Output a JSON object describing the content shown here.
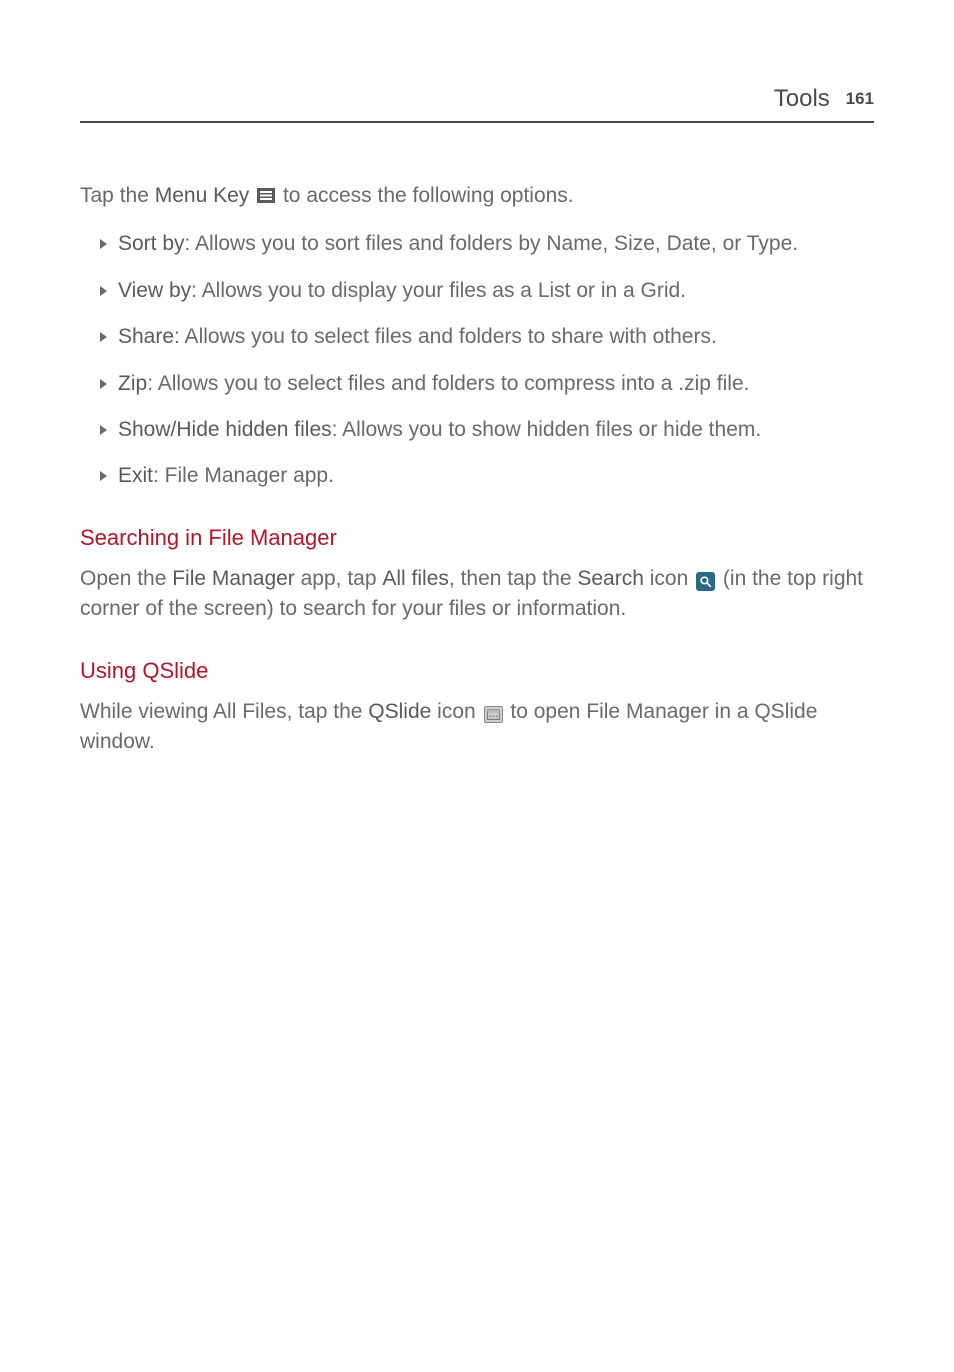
{
  "header": {
    "section": "Tools",
    "page": "161"
  },
  "intro": {
    "prefix": "Tap the ",
    "bold1": "Menu Key",
    "suffix": " to access the following options."
  },
  "items": [
    {
      "bold": "Sort by",
      "desc": ": Allows you to sort files and folders by Name, Size, Date, or Type."
    },
    {
      "bold": "View by",
      "desc": ": Allows you to display your files as a List or in a Grid."
    },
    {
      "bold": "Share",
      "desc": ": Allows you to select files and folders to share with others."
    },
    {
      "bold": "Zip",
      "desc": ": Allows you to select files and folders to compress into a .zip file."
    },
    {
      "bold": "Show/Hide hidden files",
      "desc": ": Allows you to show hidden files or hide them."
    },
    {
      "bold": "Exit",
      "desc": ": File Manager app."
    }
  ],
  "section1": {
    "heading": "Searching in File Manager",
    "p1_1": "Open the ",
    "p1_b1": "File Manager",
    "p1_2": " app, tap ",
    "p1_b2": "All files",
    "p1_3": ", then tap the ",
    "p1_b3": "Search",
    "p1_4": " icon ",
    "p1_5": " (in the top right corner of the screen) to search for your files or information."
  },
  "section2": {
    "heading": "Using QSlide",
    "p1_1": "While viewing All Files, tap the ",
    "p1_b1": "QSlide",
    "p1_2": " icon ",
    "p1_3": " to open File Manager in a QSlide window."
  }
}
